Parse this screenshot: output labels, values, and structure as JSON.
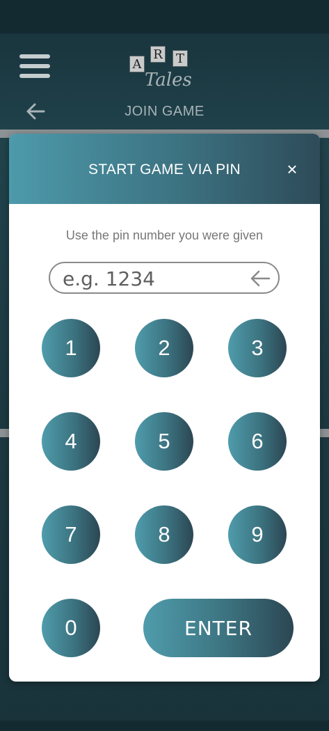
{
  "header": {
    "logo_letters": [
      "A",
      "R",
      "T"
    ],
    "logo_word": "Tales",
    "page_title": "JOIN GAME"
  },
  "modal": {
    "title": "START GAME VIA PIN",
    "close_label": "×",
    "instruction": "Use the pin number you were given",
    "pin_placeholder": "e.g. 1234",
    "pin_value": "",
    "keys": [
      "1",
      "2",
      "3",
      "4",
      "5",
      "6",
      "7",
      "8",
      "9",
      "0"
    ],
    "enter_label": "ENTER"
  },
  "colors": {
    "accent_start": "#4f9cac",
    "accent_end": "#2c4653",
    "background": "#1f3a41"
  },
  "icons": {
    "menu": "hamburger-menu-icon",
    "back": "back-arrow-icon",
    "close": "close-icon",
    "backspace": "backspace-arrow-icon"
  }
}
